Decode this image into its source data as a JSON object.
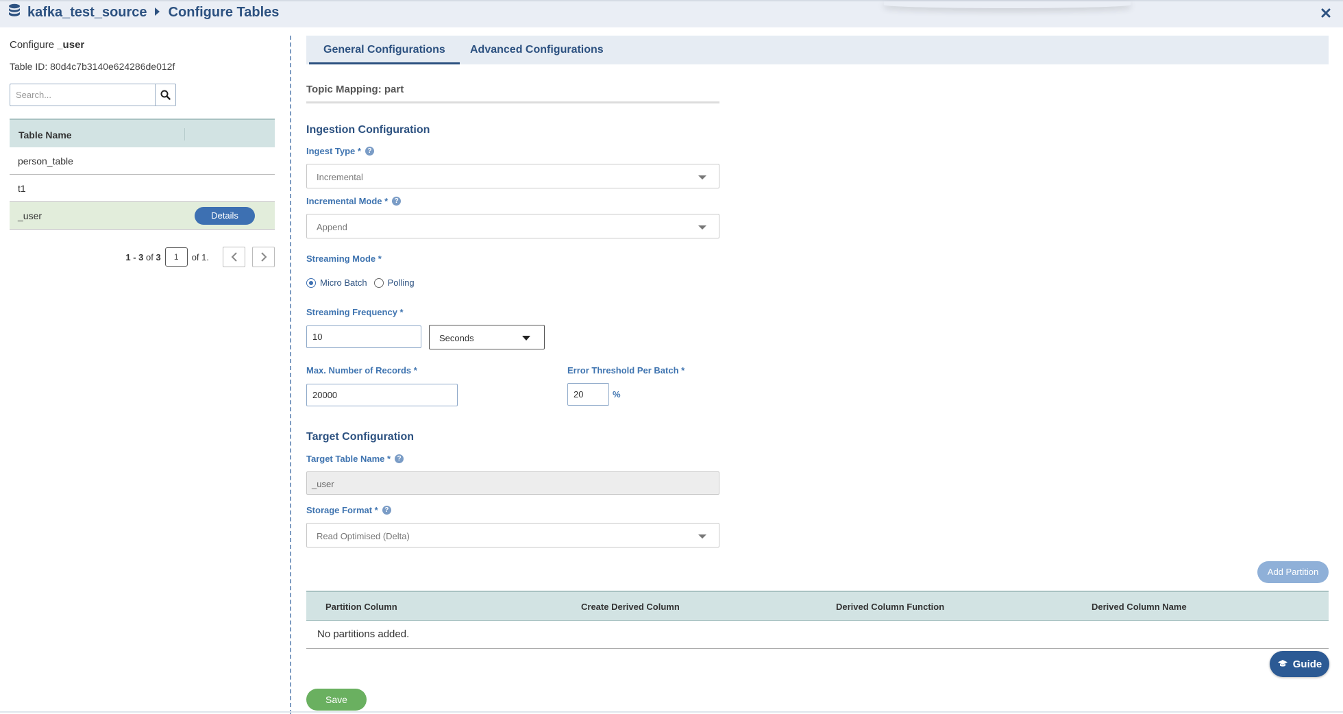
{
  "header": {
    "source_name": "kafka_test_source",
    "page_title": "Configure Tables",
    "close_symbol": "✕"
  },
  "left": {
    "configure_prefix": "Configure",
    "configure_table": "_user",
    "table_id": "Table ID: 80d4c7b3140e624286de012f",
    "search_placeholder": "Search...",
    "table_header": "Table Name",
    "rows": [
      {
        "name": "person_table"
      },
      {
        "name": "t1"
      },
      {
        "name": "_user",
        "action": "Details"
      }
    ],
    "pager": {
      "range": "1 - 3",
      "of_label": "of",
      "total": "3",
      "current_page": "1",
      "of_pages": "of 1."
    }
  },
  "tabs": [
    "General Configurations",
    "Advanced Configurations"
  ],
  "topic_mapping": "Topic Mapping: part",
  "ingestion": {
    "title": "Ingestion Configuration",
    "ingest_type_label": "Ingest Type *",
    "ingest_type_value": "Incremental",
    "incremental_mode_label": "Incremental Mode *",
    "incremental_mode_value": "Append",
    "streaming_mode_label": "Streaming Mode *",
    "streaming_options": [
      "Micro Batch",
      "Polling"
    ],
    "streaming_selected": "Micro Batch",
    "frequency_label": "Streaming Frequency *",
    "frequency_value": "10",
    "frequency_unit": "Seconds",
    "max_records_label": "Max. Number of Records *",
    "max_records_value": "20000",
    "error_threshold_label": "Error Threshold Per Batch *",
    "error_threshold_value": "20",
    "percent_symbol": "%"
  },
  "target": {
    "title": "Target Configuration",
    "table_name_label": "Target Table Name *",
    "table_name_value": "_user",
    "storage_format_label": "Storage Format *",
    "storage_format_value": "Read Optimised (Delta)"
  },
  "partitions": {
    "add_button": "Add Partition",
    "columns": [
      "Partition Column",
      "Create Derived Column",
      "Derived Column Function",
      "Derived Column Name"
    ],
    "empty_text": "No partitions added."
  },
  "guide_button": "Guide",
  "save_button": "Save",
  "colors": {
    "primary": "#2c5180",
    "label": "#3f74b0",
    "selected_row": "#e2eddb",
    "table_header": "#d2e3e3",
    "save": "#6ab060"
  }
}
